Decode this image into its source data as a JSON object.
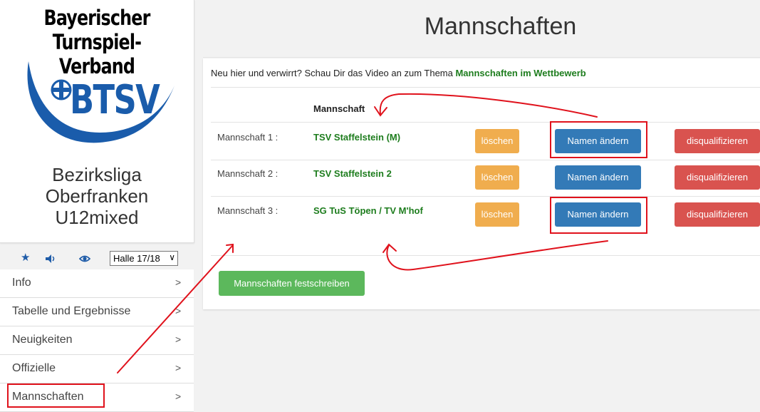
{
  "logo": {
    "line1": "Bayerischer",
    "line2": "Turnspiel-Verband",
    "emblem_text": "BTSV"
  },
  "league": {
    "line1": "Bezirksliga",
    "line2": "Oberfranken",
    "line3": "U12mixed"
  },
  "toolbar": {
    "icons": [
      "star-icon",
      "speaker-icon",
      "eye-icon"
    ],
    "season_selected": "Halle 17/18"
  },
  "nav": {
    "items": [
      {
        "label": "Info",
        "arrow": ">"
      },
      {
        "label": "Tabelle und Ergebnisse",
        "arrow": ">"
      },
      {
        "label": "Neuigkeiten",
        "arrow": ">"
      },
      {
        "label": "Offizielle",
        "arrow": ">"
      },
      {
        "label": "Mannschaften",
        "arrow": ">"
      }
    ]
  },
  "main": {
    "title": "Mannschaften",
    "intro_text": "Neu hier und verwirrt? Schau Dir das Video an zum Thema ",
    "intro_link": "Mannschaften im Wettbewerb",
    "column_header": "Mannschaft",
    "rows": [
      {
        "label": "Mannschaft 1 :",
        "team": "TSV Staffelstein (M)",
        "delete": "löschen",
        "rename": "Namen ändern",
        "disqualify": "disqualifizieren"
      },
      {
        "label": "Mannschaft 2 :",
        "team": "TSV Staffelstein 2",
        "delete": "löschen",
        "rename": "Namen ändern",
        "disqualify": "disqualifizieren"
      },
      {
        "label": "Mannschaft 3 :",
        "team": "SG TuS Töpen / TV M'hof",
        "delete": "löschen",
        "rename": "Namen ändern",
        "disqualify": "disqualifizieren"
      }
    ],
    "commit_button": "Mannschaften festschreiben"
  },
  "colors": {
    "brand_blue": "#1a5cab",
    "team_green": "#1e7d1e",
    "delete_orange": "#f0ad4e",
    "rename_blue": "#337ab7",
    "disqualify_red": "#d9534f",
    "commit_green": "#5cb85c",
    "annotation_red": "#e0121c"
  }
}
